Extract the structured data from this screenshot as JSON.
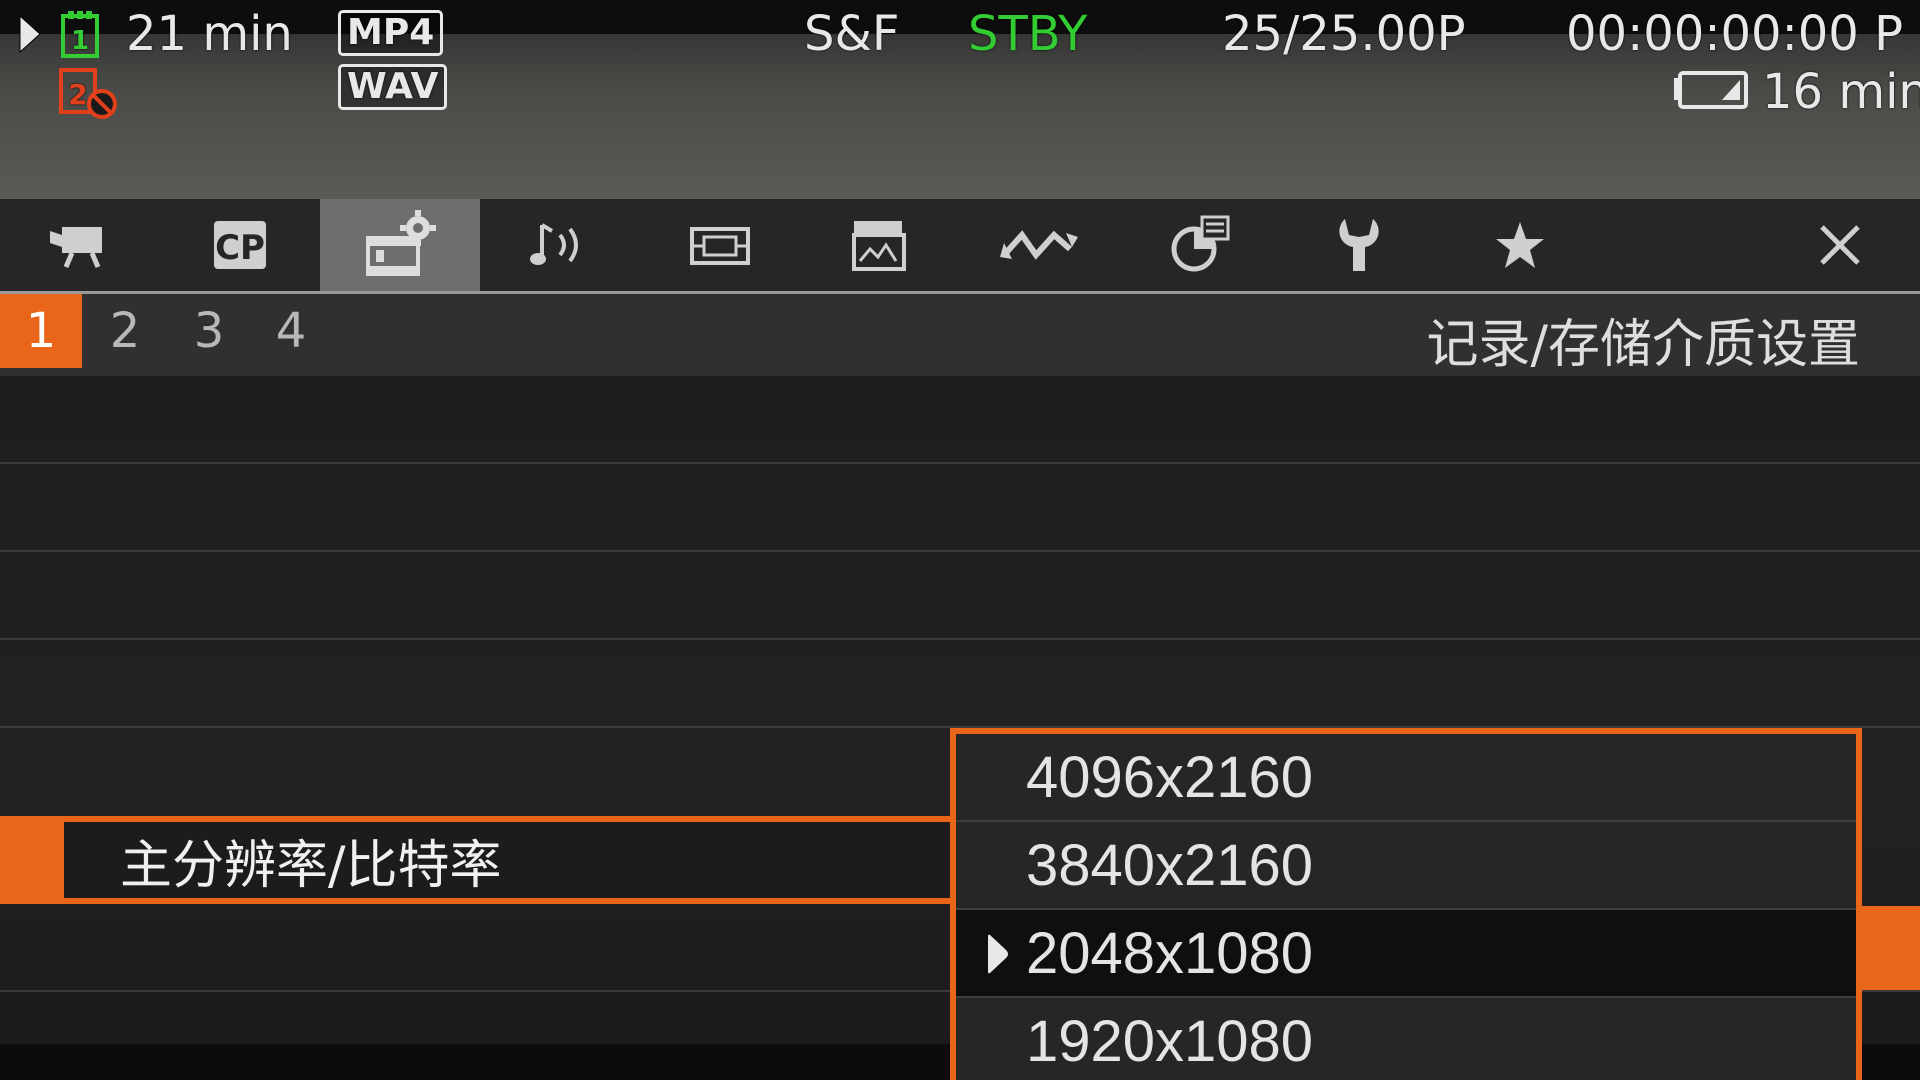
{
  "status": {
    "card1_remaining": "21 min",
    "video_format": "MP4",
    "audio_format": "WAV",
    "mode": "S&F",
    "rec_state": "STBY",
    "frame_rate": "25/25.00P",
    "timecode": "00:00:00:00 P",
    "battery_remaining": "16 min",
    "card1_label": "1",
    "card2_label": "2",
    "icons": [
      "play-icon",
      "sd-card-1-icon",
      "sd-card-2-disabled-icon",
      "battery-icon"
    ],
    "colors": {
      "rec_state": "#33cc33",
      "card1": "#33cc33",
      "card2": "#e0401a"
    }
  },
  "tabs": [
    {
      "icon": "camera-icon"
    },
    {
      "label": "CP",
      "icon": "custom-picture-icon"
    },
    {
      "icon": "recording-settings-icon",
      "active": true
    },
    {
      "icon": "audio-icon"
    },
    {
      "icon": "display-icon"
    },
    {
      "icon": "clapper-icon"
    },
    {
      "icon": "waveform-icon"
    },
    {
      "icon": "assist-icon"
    },
    {
      "icon": "wrench-icon"
    },
    {
      "icon": "star-icon"
    },
    {
      "icon": "close-icon"
    }
  ],
  "pages": [
    "1",
    "2",
    "3",
    "4"
  ],
  "active_page": "1",
  "page_title": "记录/存储介质设置",
  "selected_item": "主分辨率/比特率",
  "options": [
    "4096x2160",
    "3840x2160",
    "2048x1080",
    "1920x1080"
  ],
  "current_option": "2048x1080",
  "accent_color": "#e8651a"
}
